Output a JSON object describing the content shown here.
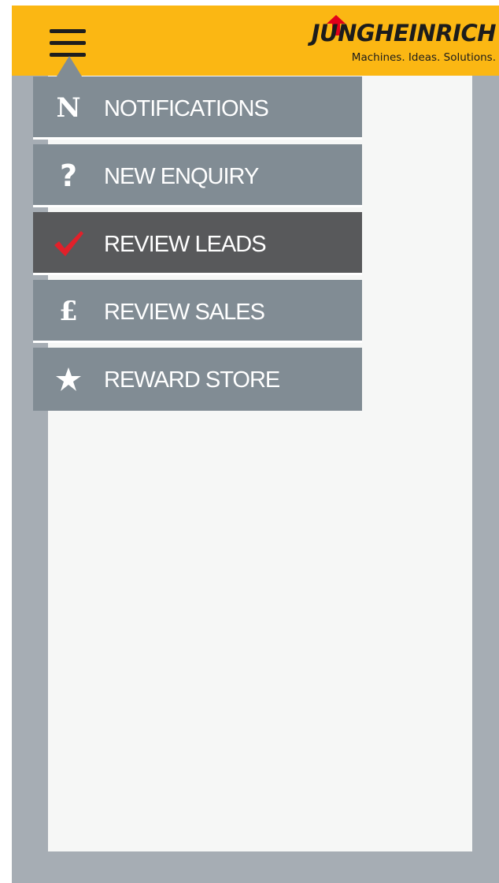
{
  "header": {
    "brand": "JUNGHEINRICH",
    "tagline": "Machines. Ideas. Solutions.",
    "accent_color": "#fbb713",
    "arrow_color": "#e2001a"
  },
  "menu": {
    "toggle_icon": "hamburger-menu-icon",
    "items": [
      {
        "label": "NOTIFICATIONS",
        "icon": "letter-n-icon",
        "glyph": "N",
        "active": false
      },
      {
        "label": "NEW ENQUIRY",
        "icon": "question-mark-icon",
        "glyph": "?",
        "active": false
      },
      {
        "label": "REVIEW LEADS",
        "icon": "checkmark-icon",
        "glyph": "",
        "active": true
      },
      {
        "label": "REVIEW SALES",
        "icon": "pound-sign-icon",
        "glyph": "£",
        "active": false
      },
      {
        "label": "REWARD STORE",
        "icon": "star-icon",
        "glyph": "",
        "active": false
      }
    ]
  },
  "colors": {
    "menu_item_bg": "#818c94",
    "menu_item_active_bg": "#58595b",
    "check_color": "#e2202a",
    "frame_bg": "#a6adb4",
    "panel_bg": "#f6f7f6"
  }
}
